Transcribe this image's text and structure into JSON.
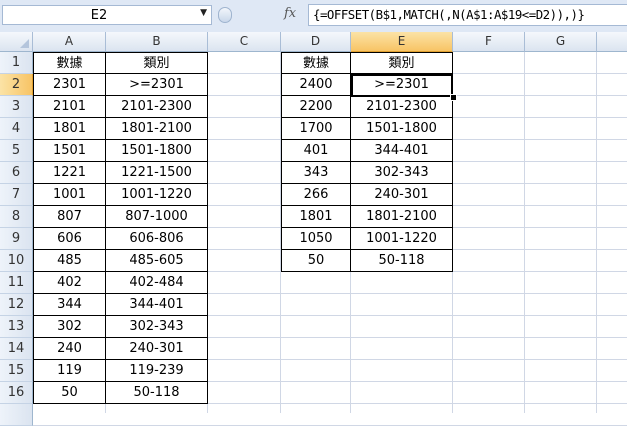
{
  "name_box": "E2",
  "formula": "{=OFFSET(B$1,MATCH(,N(A$1:A$19<=D2)),)}",
  "fx_icon": "fx",
  "columns": [
    "A",
    "B",
    "C",
    "D",
    "E",
    "F",
    "G"
  ],
  "rows": [
    "1",
    "2",
    "3",
    "4",
    "5",
    "6",
    "7",
    "8",
    "9",
    "10",
    "11",
    "12",
    "13",
    "14",
    "15",
    "16"
  ],
  "left_table": {
    "headers": [
      "數據",
      "類別"
    ],
    "rows": [
      [
        "2301",
        ">=2301"
      ],
      [
        "2101",
        "2101-2300"
      ],
      [
        "1801",
        "1801-2100"
      ],
      [
        "1501",
        "1501-1800"
      ],
      [
        "1221",
        "1221-1500"
      ],
      [
        "1001",
        "1001-1220"
      ],
      [
        "807",
        "807-1000"
      ],
      [
        "606",
        "606-806"
      ],
      [
        "485",
        "485-605"
      ],
      [
        "402",
        "402-484"
      ],
      [
        "344",
        "344-401"
      ],
      [
        "302",
        "302-343"
      ],
      [
        "240",
        "240-301"
      ],
      [
        "119",
        "119-239"
      ],
      [
        "50",
        "50-118"
      ]
    ]
  },
  "right_table": {
    "headers": [
      "數據",
      "類別"
    ],
    "rows": [
      [
        "2400",
        ">=2301"
      ],
      [
        "2200",
        "2101-2300"
      ],
      [
        "1700",
        "1501-1800"
      ],
      [
        "401",
        "344-401"
      ],
      [
        "343",
        "302-343"
      ],
      [
        "266",
        "240-301"
      ],
      [
        "1801",
        "1801-2100"
      ],
      [
        "1050",
        "1001-1220"
      ],
      [
        "50",
        "50-118"
      ]
    ]
  }
}
